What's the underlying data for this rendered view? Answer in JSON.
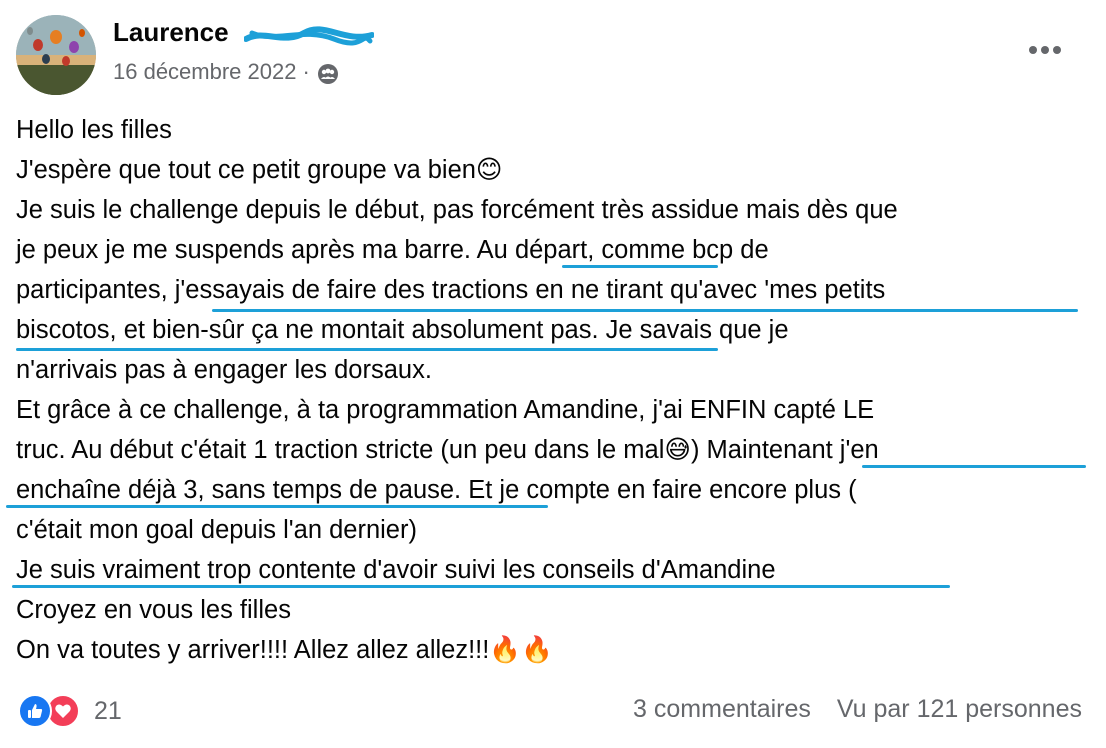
{
  "post": {
    "author": "Laurence",
    "date": "16 décembre 2022",
    "separator": "·",
    "audience_icon": "group-icon",
    "more_icon": "more-options-icon",
    "lines": [
      "Hello les filles",
      "J'espère que tout ce petit groupe va bien😊",
      "Je suis le challenge depuis le début, pas forcément très assidue mais dès que",
      "je peux je me suspends après ma barre. Au départ, comme bcp de",
      "participantes, j'essayais de faire des tractions en ne tirant qu'avec 'mes petits",
      "biscotos, et bien-sûr ça ne montait absolument pas. Je savais que je",
      "n'arrivais pas à engager les dorsaux.",
      "Et grâce à ce challenge, à ta programmation Amandine, j'ai ENFIN capté LE",
      "truc. Au début c'était 1 traction stricte (un peu dans le mal😅) Maintenant j'en",
      "enchaîne déjà 3, sans temps de pause. Et je compte en faire encore plus (",
      "c'était mon goal depuis l'an dernier)",
      "Je suis vraiment trop contente d'avoir suivi les conseils d'Amandine",
      "Croyez en vous les filles",
      "On va toutes y arriver!!!! Allez allez allez!!!🔥🔥"
    ],
    "highlight_color": "#1da0d8"
  },
  "footer": {
    "reaction_icons": [
      "like-icon",
      "love-icon"
    ],
    "reaction_count": "21",
    "comments": "3 commentaires",
    "views": "Vu par 121 personnes"
  }
}
